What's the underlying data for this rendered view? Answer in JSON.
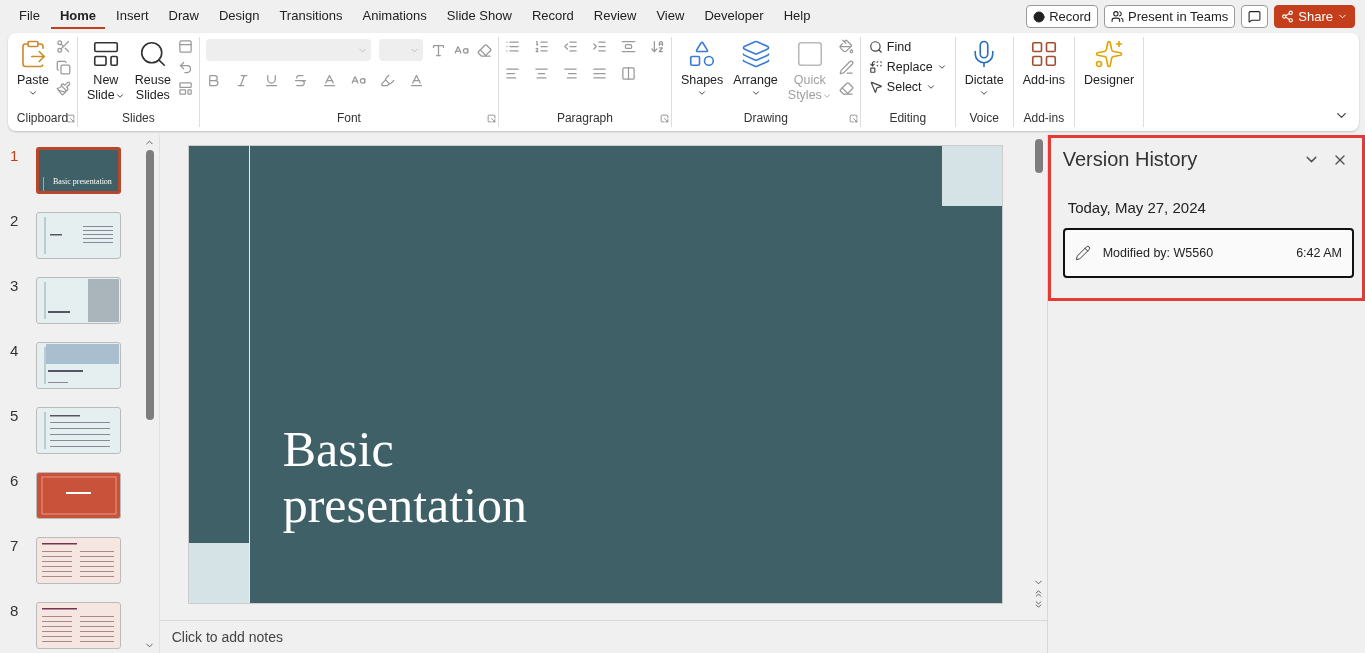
{
  "menu_tabs": [
    {
      "label": "File",
      "selected": false
    },
    {
      "label": "Home",
      "selected": true
    },
    {
      "label": "Insert",
      "selected": false
    },
    {
      "label": "Draw",
      "selected": false
    },
    {
      "label": "Design",
      "selected": false
    },
    {
      "label": "Transitions",
      "selected": false
    },
    {
      "label": "Animations",
      "selected": false
    },
    {
      "label": "Slide Show",
      "selected": false
    },
    {
      "label": "Record",
      "selected": false
    },
    {
      "label": "Review",
      "selected": false
    },
    {
      "label": "View",
      "selected": false
    },
    {
      "label": "Developer",
      "selected": false
    },
    {
      "label": "Help",
      "selected": false
    }
  ],
  "top_buttons": [
    {
      "kind": "record",
      "label": "Record"
    },
    {
      "kind": "teams",
      "label": "Present in Teams"
    },
    {
      "kind": "comments"
    },
    {
      "kind": "share",
      "label": "Share"
    }
  ],
  "ribbon": [
    {
      "kind": "clipboard",
      "label": "Clipboard",
      "launcher": true,
      "large": [
        {
          "lines": [
            "Paste"
          ],
          "dropdown": true
        }
      ]
    },
    {
      "kind": "slides",
      "label": "Slides",
      "large": [
        {
          "lines": [
            "New",
            "Slide"
          ],
          "dropdown": true
        },
        {
          "lines": [
            "Reuse",
            "Slides"
          ]
        }
      ]
    },
    {
      "kind": "font",
      "label": "Font",
      "launcher": true
    },
    {
      "kind": "paragraph",
      "label": "Paragraph",
      "launcher": true
    },
    {
      "kind": "drawing",
      "label": "Drawing",
      "launcher": true,
      "large": [
        {
          "lines": [
            "Shapes"
          ],
          "dropdown": true
        },
        {
          "lines": [
            "Arrange"
          ],
          "dropdown": true
        },
        {
          "lines": [
            "Quick",
            "Styles"
          ],
          "dropdown": true,
          "disabled": true
        }
      ]
    },
    {
      "kind": "editing",
      "label": "Editing",
      "small": [
        {
          "label": "Find"
        },
        {
          "label": "Replace",
          "dropdown": true
        },
        {
          "label": "Select",
          "dropdown": true
        }
      ]
    },
    {
      "kind": "voice",
      "label": "Voice",
      "large": [
        {
          "lines": [
            "Dictate"
          ],
          "dropdown": true
        }
      ]
    },
    {
      "kind": "addins",
      "label": "Add-ins",
      "large": [
        {
          "lines": [
            "Add-ins"
          ]
        }
      ]
    },
    {
      "kind": "designer",
      "large": [
        {
          "lines": [
            "Designer"
          ]
        }
      ]
    }
  ],
  "slides": [
    {
      "number": "1",
      "selected": true,
      "kind": "title",
      "title": "Basic presentation"
    },
    {
      "number": "2",
      "selected": false,
      "kind": "agenda"
    },
    {
      "number": "3",
      "selected": false,
      "kind": "photo-right"
    },
    {
      "number": "4",
      "selected": false,
      "kind": "photo-top"
    },
    {
      "number": "5",
      "selected": false,
      "kind": "bullets"
    },
    {
      "number": "6",
      "selected": false,
      "kind": "accent"
    },
    {
      "number": "7",
      "selected": false,
      "kind": "columns"
    },
    {
      "number": "8",
      "selected": false,
      "kind": "columns"
    }
  ],
  "current_slide": {
    "title": "Basic presentation"
  },
  "notes": {
    "placeholder": "Click to add notes"
  },
  "version_history": {
    "title": "Version History",
    "highlighted": true,
    "date": "Today, May 27, 2024",
    "entries": [
      {
        "text": "Modified by: W5560",
        "time": "6:42 AM",
        "selected": true
      }
    ]
  }
}
